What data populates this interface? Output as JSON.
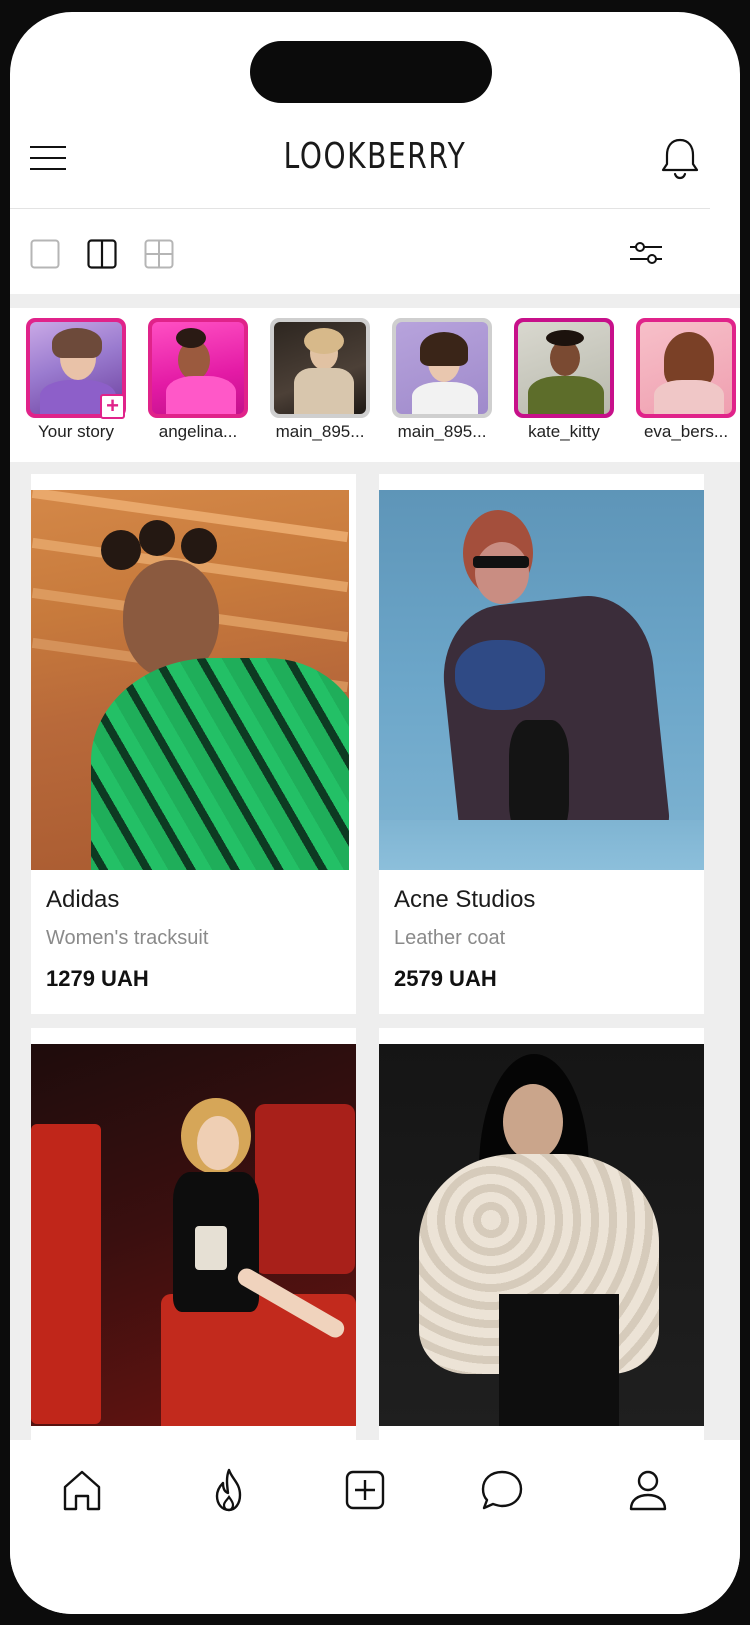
{
  "app": {
    "brand": "LOOKBERRY"
  },
  "toolbar": {
    "layouts": [
      "single",
      "double",
      "grid"
    ],
    "active_layout": "double"
  },
  "stories": [
    {
      "name": "Your story",
      "ring": "#e0238a",
      "add": "+"
    },
    {
      "name": "angelina...",
      "ring": "#e0238a"
    },
    {
      "name": "main_895...",
      "ring": "#cfcfcf"
    },
    {
      "name": "main_895...",
      "ring": "#cfcfcf"
    },
    {
      "name": "kate_kitty",
      "ring": "#c7108a"
    },
    {
      "name": "eva_bers...",
      "ring": "#e0238a"
    }
  ],
  "products": [
    {
      "brand": "Adidas",
      "item": "Women's tracksuit",
      "price": "1279 UAH"
    },
    {
      "brand": "Acne Studios",
      "item": "Leather coat",
      "price": "2579 UAH"
    }
  ],
  "bottom_nav": [
    "home",
    "trending",
    "create",
    "messages",
    "profile"
  ],
  "colors": {
    "accent": "#e0238a",
    "background": "#eeeeee",
    "text": "#111111"
  }
}
